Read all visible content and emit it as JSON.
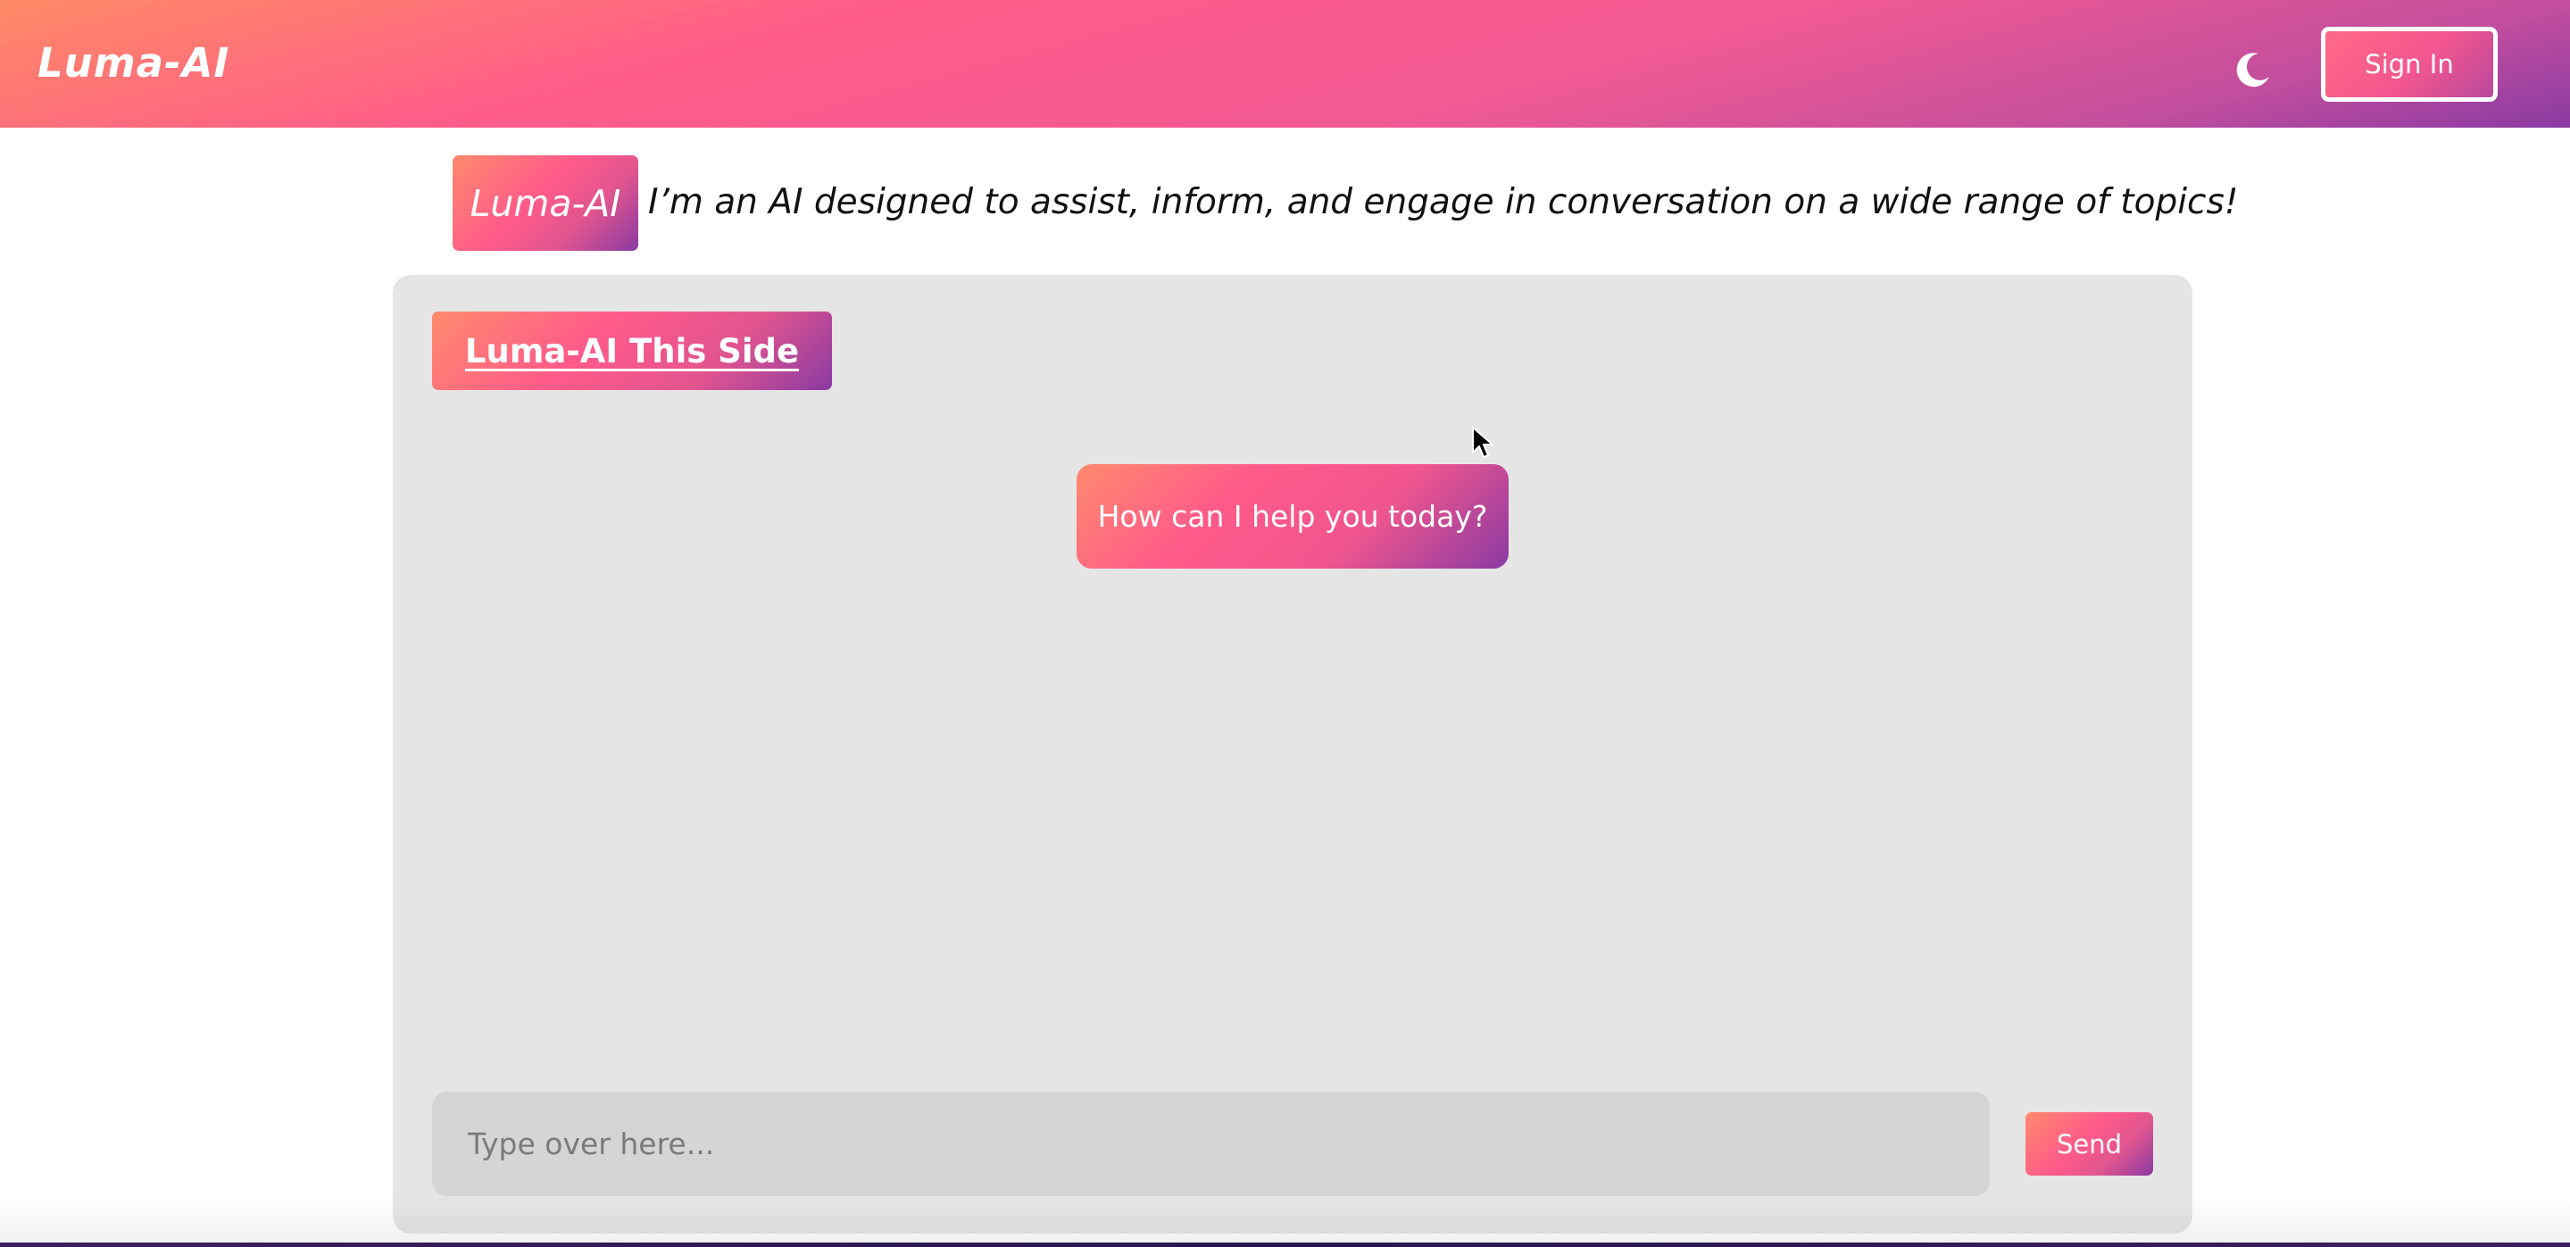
{
  "header": {
    "brand": "Luma-AI",
    "theme_toggle_icon": "moon-icon",
    "signin_label": "Sign In"
  },
  "intro": {
    "badge": "Luma-AI",
    "text": "I’m an AI designed to assist, inform, and engage in conversation on a wide range of topics!"
  },
  "chat": {
    "title": "Luma-AI This Side",
    "messages": [
      {
        "sender": "bot",
        "text": "How can I help you today?"
      }
    ],
    "input": {
      "value": "",
      "placeholder": "Type over here..."
    },
    "send_label": "Send"
  },
  "colors": {
    "gradient_start": "#ff8a66",
    "gradient_mid": "#ff5c8a",
    "gradient_end": "#8a3aa3",
    "card_bg": "#e5e5e5",
    "input_bg": "#d5d5d5"
  }
}
